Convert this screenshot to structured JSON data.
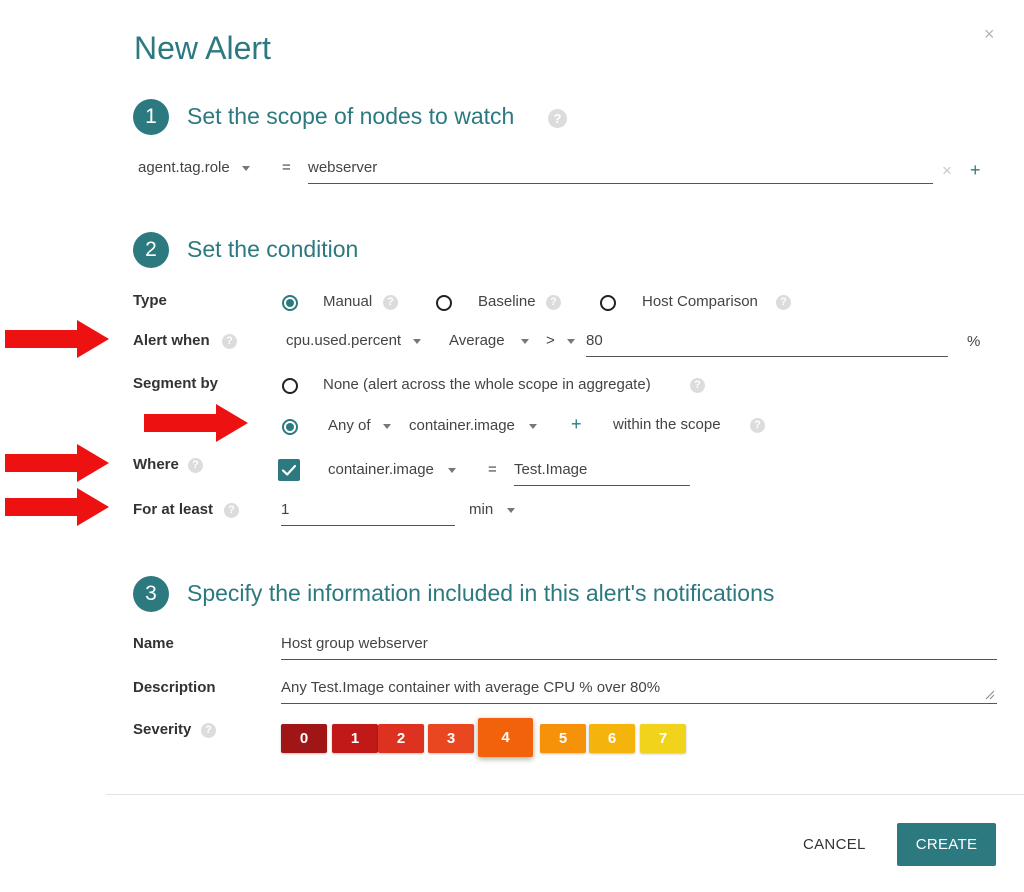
{
  "dialog": {
    "title": "New Alert",
    "close_glyph": "×"
  },
  "step1": {
    "number": "1",
    "title": "Set the scope of nodes to watch",
    "scope_key": "agent.tag.role",
    "operator": "=",
    "scope_value": "webserver",
    "clear_glyph": "×",
    "add_glyph": "+"
  },
  "step2": {
    "number": "2",
    "title": "Set the condition",
    "type": {
      "label": "Type",
      "options": [
        "Manual",
        "Baseline",
        "Host Comparison"
      ],
      "selected": "Manual"
    },
    "alert_when": {
      "label": "Alert when",
      "metric": "cpu.used.percent",
      "aggregation": "Average",
      "comparator": ">",
      "threshold": "80",
      "unit": "%"
    },
    "segment_by": {
      "label": "Segment by",
      "none_option": "None (alert across the whole scope in aggregate)",
      "any_of": "Any of",
      "segment_field": "container.image",
      "add_glyph": "+",
      "scope_text": "within the scope",
      "selected": "Any of"
    },
    "where": {
      "label": "Where",
      "checked": true,
      "field": "container.image",
      "operator": "=",
      "value": "Test.Image"
    },
    "for_at_least": {
      "label": "For at least",
      "value": "1",
      "unit": "min"
    }
  },
  "step3": {
    "number": "3",
    "title": "Specify the information included in this alert's notifications",
    "name_label": "Name",
    "name_value": "Host group webserver",
    "description_label": "Description",
    "description_value": "Any Test.Image container with average CPU % over 80%",
    "severity_label": "Severity",
    "severity_levels": [
      {
        "label": "0",
        "color": "#a01515"
      },
      {
        "label": "1",
        "color": "#c11818"
      },
      {
        "label": "2",
        "color": "#de3220"
      },
      {
        "label": "3",
        "color": "#e8471f"
      },
      {
        "label": "4",
        "color": "#f2620a"
      },
      {
        "label": "5",
        "color": "#f5920a"
      },
      {
        "label": "6",
        "color": "#f4b40c"
      },
      {
        "label": "7",
        "color": "#f2d31c"
      }
    ],
    "selected_severity": "4"
  },
  "footer": {
    "cancel_label": "CANCEL",
    "create_label": "CREATE"
  },
  "help_glyph": "?",
  "colors": {
    "accent": "#2c7a80",
    "annotation_arrow": "#ee1111"
  }
}
